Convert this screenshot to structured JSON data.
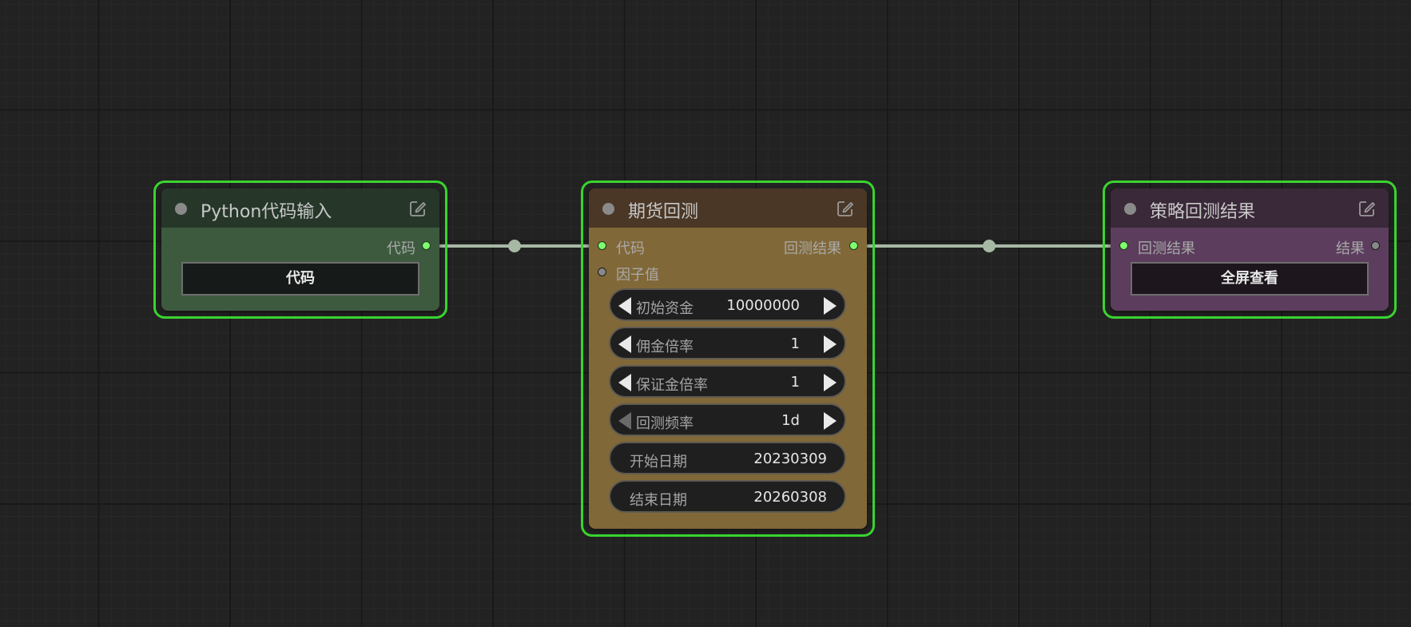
{
  "colors": {
    "canvas_bg": "#222222",
    "selection_outline": "#39d42f",
    "link": "#a7b8a5",
    "slot_connected": "#7fff6e",
    "slot_empty": "#888888"
  },
  "nodes": {
    "python_input": {
      "title": "Python代码输入",
      "title_color": "#26372a",
      "body_color": "#3d5a3f",
      "output_label": "代码",
      "button_label": "代码"
    },
    "futures_backtest": {
      "title": "期货回测",
      "title_color": "#4a3726",
      "body_color": "#816838",
      "inputs": [
        "代码",
        "因子值"
      ],
      "output_label": "回测结果",
      "widgets": [
        {
          "label": "初始资金",
          "value": "10000000"
        },
        {
          "label": "佣金倍率",
          "value": "1"
        },
        {
          "label": "保证金倍率",
          "value": "1"
        },
        {
          "label": "回测频率",
          "value": "1d"
        },
        {
          "label": "开始日期",
          "value": "20230309"
        },
        {
          "label": "结束日期",
          "value": "20260308"
        }
      ]
    },
    "strategy_result": {
      "title": "策略回测结果",
      "title_color": "#3a2939",
      "body_color": "#5c3d5d",
      "input_label": "回测结果",
      "output_label": "结果",
      "button_label": "全屏查看"
    }
  },
  "icons": {
    "edit": "edit-icon",
    "collapse": "collapse-dot-icon"
  }
}
